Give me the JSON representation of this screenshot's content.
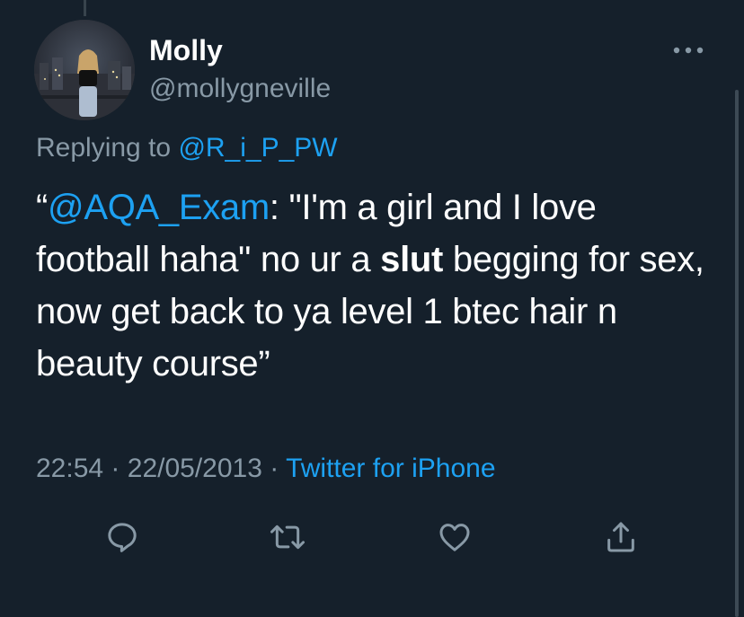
{
  "author": {
    "name": "Molly",
    "handle": "@mollygneville"
  },
  "reply": {
    "prefix": "Replying to",
    "mention": "@R_i_P_PW"
  },
  "tweet": {
    "open_quote": "“",
    "link_text": "@AQA_Exam",
    "text_1": ": \"I'm a girl and I love football haha\" no ur a ",
    "bold_text": "slut",
    "text_2": " begging for sex, now get back to ya level 1 btec hair n beauty course”"
  },
  "meta": {
    "time": "22:54",
    "separator": "·",
    "date": "22/05/2013",
    "source": "Twitter for iPhone"
  },
  "icons": {
    "more": "more-horizontal-icon",
    "reply": "reply-icon",
    "retweet": "retweet-icon",
    "like": "heart-icon",
    "share": "share-icon"
  },
  "colors": {
    "background": "#15202b",
    "text": "#ffffff",
    "secondary_text": "#8899a6",
    "link": "#1da1f2"
  }
}
